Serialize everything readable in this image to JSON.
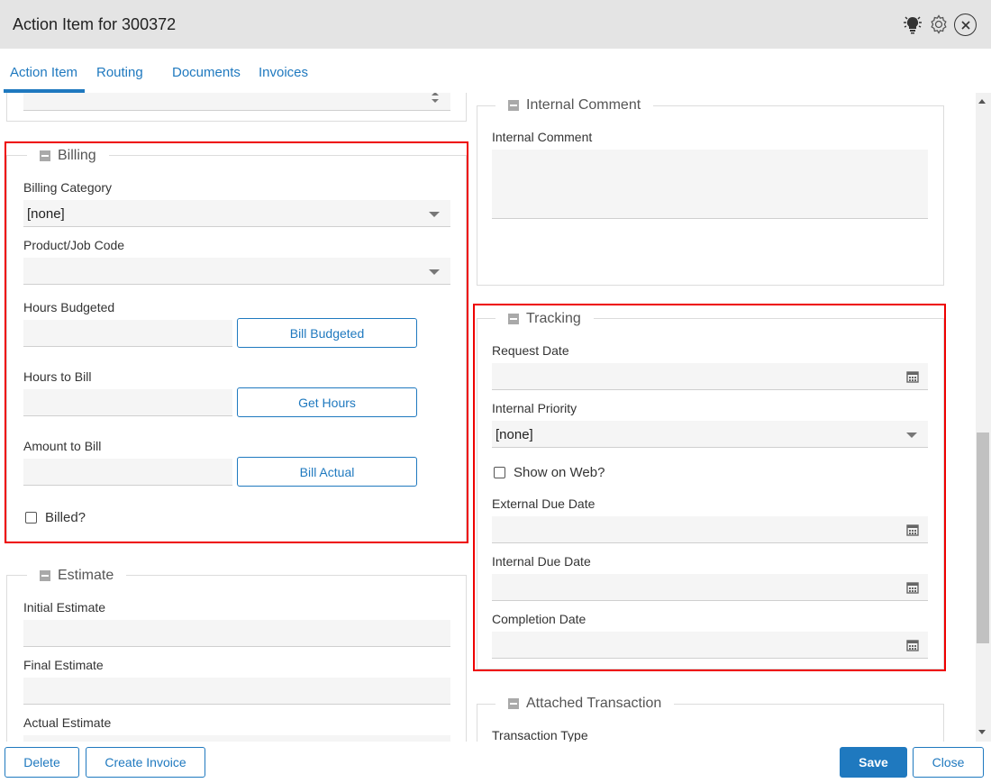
{
  "window": {
    "title": "Action Item for 300372"
  },
  "toolbar_icons": [
    "lightbulb-icon",
    "gear-icon",
    "close-icon"
  ],
  "tabs": [
    "Action Item",
    "Routing",
    "Documents",
    "Invoices"
  ],
  "billing": {
    "legend": "Billing",
    "billing_category_label": "Billing Category",
    "billing_category_value": "[none]",
    "product_job_code_label": "Product/Job Code",
    "product_job_code_value": "",
    "hours_budgeted_label": "Hours Budgeted",
    "bill_budgeted_button": "Bill Budgeted",
    "hours_to_bill_label": "Hours to Bill",
    "get_hours_button": "Get Hours",
    "amount_to_bill_label": "Amount to Bill",
    "bill_actual_button": "Bill Actual",
    "billed_label": "Billed?"
  },
  "estimate": {
    "legend": "Estimate",
    "initial_estimate_label": "Initial Estimate",
    "final_estimate_label": "Final Estimate",
    "actual_estimate_label": "Actual Estimate"
  },
  "internal_comment": {
    "legend": "Internal Comment",
    "label": "Internal Comment"
  },
  "tracking": {
    "legend": "Tracking",
    "request_date_label": "Request Date",
    "internal_priority_label": "Internal Priority",
    "internal_priority_value": "[none]",
    "show_on_web_label": "Show on Web?",
    "external_due_date_label": "External Due Date",
    "internal_due_date_label": "Internal Due Date",
    "completion_date_label": "Completion Date"
  },
  "attached_transaction": {
    "legend": "Attached Transaction",
    "transaction_type_label": "Transaction Type"
  },
  "footer": {
    "delete": "Delete",
    "create_invoice": "Create Invoice",
    "save": "Save",
    "close": "Close"
  },
  "colors": {
    "accent": "#1f79bf",
    "highlight": "#e00000"
  }
}
